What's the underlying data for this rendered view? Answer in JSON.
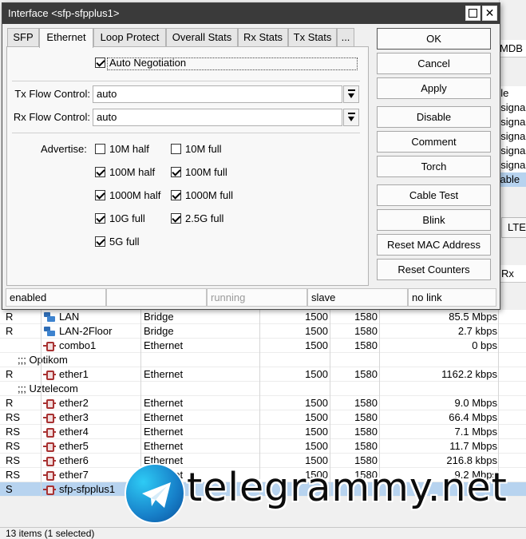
{
  "window": {
    "title": "Interface <sfp-sfpplus1>",
    "maximize_glyph": "maximize-icon",
    "close_glyph": "✕"
  },
  "tabs": [
    "SFP",
    "Ethernet",
    "Loop Protect",
    "Overall Stats",
    "Rx Stats",
    "Tx Stats",
    "..."
  ],
  "active_tab": "Ethernet",
  "ethernet": {
    "auto_negotiation": {
      "label": "Auto Negotiation",
      "checked": true
    },
    "tx_flow_control": {
      "label": "Tx Flow Control:",
      "value": "auto"
    },
    "rx_flow_control": {
      "label": "Rx Flow Control:",
      "value": "auto"
    },
    "advertise_label": "Advertise:",
    "advertise": [
      {
        "label": "10M half",
        "checked": false
      },
      {
        "label": "10M full",
        "checked": false
      },
      {
        "label": "100M half",
        "checked": true
      },
      {
        "label": "100M full",
        "checked": true
      },
      {
        "label": "1000M half",
        "checked": true
      },
      {
        "label": "1000M full",
        "checked": true
      },
      {
        "label": "10G full",
        "checked": true
      },
      {
        "label": "2.5G full",
        "checked": true
      },
      {
        "label": "5G full",
        "checked": true
      }
    ]
  },
  "buttons": {
    "ok": "OK",
    "cancel": "Cancel",
    "apply": "Apply",
    "disable": "Disable",
    "comment": "Comment",
    "torch": "Torch",
    "cable_test": "Cable Test",
    "blink": "Blink",
    "reset_mac": "Reset MAC Address",
    "reset_counters": "Reset Counters"
  },
  "dialog_status": [
    "enabled",
    "",
    "running",
    "slave",
    "no link"
  ],
  "background": {
    "mdb_header": "MDB",
    "right_column": [
      "ble",
      "esigna",
      "esigna",
      "esigna",
      "esigna",
      "esigna",
      "sable"
    ],
    "lte_tab": "LTE",
    "rx_header": "Rx",
    "rows": [
      {
        "kind": "item",
        "flag": "R",
        "icon": "bridge-icon",
        "name": "LAN",
        "type": "Bridge",
        "mtu": "1500",
        "l2mtu": "1580",
        "rate": "85.5 Mbps"
      },
      {
        "kind": "item",
        "flag": "R",
        "icon": "bridge-icon",
        "name": "LAN-2Floor",
        "type": "Bridge",
        "mtu": "1500",
        "l2mtu": "1580",
        "rate": "2.7 kbps"
      },
      {
        "kind": "item",
        "flag": "",
        "icon": "ethernet-icon",
        "name": "combo1",
        "type": "Ethernet",
        "mtu": "1500",
        "l2mtu": "1580",
        "rate": "0 bps"
      },
      {
        "kind": "group",
        "text": ";;; Optikom"
      },
      {
        "kind": "item",
        "flag": "R",
        "icon": "ethernet-icon",
        "name": "ether1",
        "type": "Ethernet",
        "mtu": "1500",
        "l2mtu": "1580",
        "rate": "1162.2 kbps"
      },
      {
        "kind": "group",
        "text": ";;; Uztelecom"
      },
      {
        "kind": "item",
        "flag": "R",
        "icon": "ethernet-icon",
        "name": "ether2",
        "type": "Ethernet",
        "mtu": "1500",
        "l2mtu": "1580",
        "rate": "9.0 Mbps"
      },
      {
        "kind": "item",
        "flag": "RS",
        "icon": "ethernet-icon",
        "name": "ether3",
        "type": "Ethernet",
        "mtu": "1500",
        "l2mtu": "1580",
        "rate": "66.4 Mbps"
      },
      {
        "kind": "item",
        "flag": "RS",
        "icon": "ethernet-icon",
        "name": "ether4",
        "type": "Ethernet",
        "mtu": "1500",
        "l2mtu": "1580",
        "rate": "7.1 Mbps"
      },
      {
        "kind": "item",
        "flag": "RS",
        "icon": "ethernet-icon",
        "name": "ether5",
        "type": "Ethernet",
        "mtu": "1500",
        "l2mtu": "1580",
        "rate": "11.7 Mbps"
      },
      {
        "kind": "item",
        "flag": "RS",
        "icon": "ethernet-icon",
        "name": "ether6",
        "type": "Ethernet",
        "mtu": "1500",
        "l2mtu": "1580",
        "rate": "216.8 kbps"
      },
      {
        "kind": "item",
        "flag": "RS",
        "icon": "ethernet-icon",
        "name": "ether7",
        "type": "Ethernet",
        "mtu": "1500",
        "l2mtu": "1580",
        "rate": "9.2 Mbps"
      },
      {
        "kind": "item",
        "flag": "S",
        "icon": "ethernet-icon",
        "name": "sfp-sfpplus1",
        "type": "Ethernet",
        "mtu": "",
        "l2mtu": "",
        "rate": "",
        "selected": true
      }
    ],
    "status": "13 items (1 selected)"
  },
  "watermark": {
    "text": "telegrammy.net",
    "icon": "telegram-logo-icon"
  },
  "colors": {
    "titlebar": "#3a3a3a",
    "selection": "#b7d3ef",
    "panel": "#f8f8f8"
  }
}
